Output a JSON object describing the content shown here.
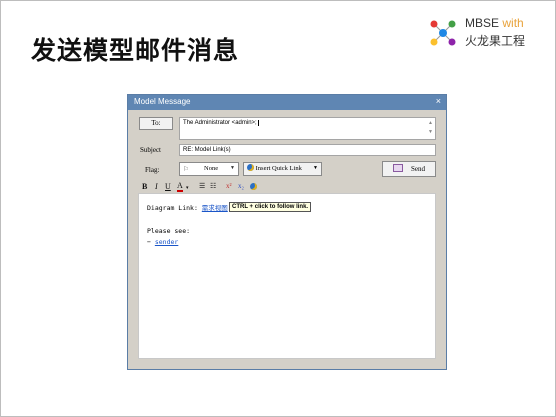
{
  "slide": {
    "title": "发送模型邮件消息",
    "logo_mbse": "MBSE",
    "logo_with": "with",
    "logo_sub": "火龙果工程"
  },
  "dialog": {
    "title": "Model Message",
    "close": "×",
    "to_button": "To:",
    "to_value": "The Administrator <admin>;",
    "subject_label": "Subject",
    "subject_value": "RE: Model Link(s)",
    "flag_label": "Flag:",
    "flag_value": "None",
    "insert_quick_link": "Insert Quick Link",
    "send": "Send",
    "format": {
      "bold": "B",
      "italic": "I",
      "underline": "U",
      "color": "A"
    },
    "body": {
      "diagram_link_label": "Diagram Link:",
      "diagram_link_text": "需求视图",
      "tooltip": "CTRL + click to follow link.",
      "please_see": "Please see:",
      "bullet": "−",
      "sender_link": "sender"
    }
  }
}
